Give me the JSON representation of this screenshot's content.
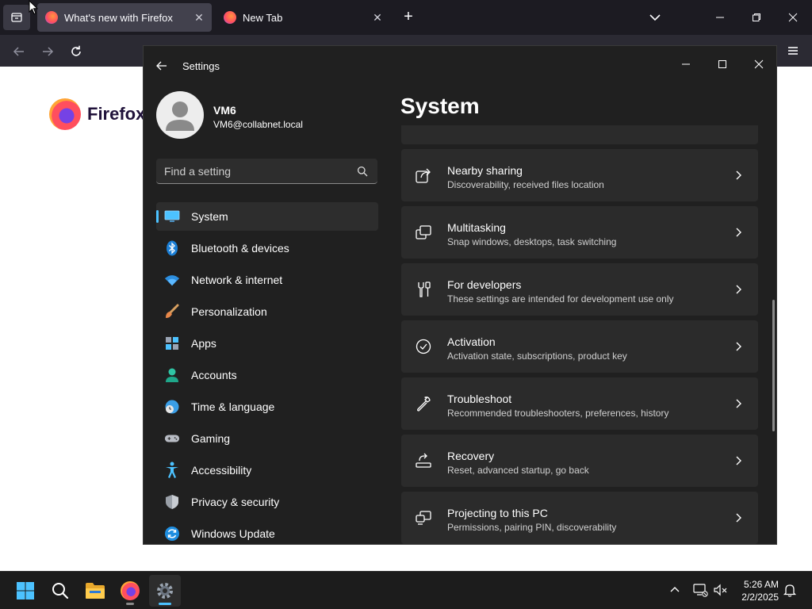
{
  "browser": {
    "tabs": [
      {
        "title": "What's new with Firefox",
        "active": true
      },
      {
        "title": "New Tab",
        "active": false
      }
    ],
    "new_tab_symbol": "+",
    "close_symbol": "✕",
    "logo_text": "Firefox"
  },
  "settings": {
    "window_title": "Settings",
    "user": {
      "name": "VM6",
      "email": "VM6@collabnet.local"
    },
    "search_placeholder": "Find a setting",
    "nav": [
      {
        "label": "System",
        "icon": "monitor-icon",
        "selected": true
      },
      {
        "label": "Bluetooth & devices",
        "icon": "bluetooth-icon"
      },
      {
        "label": "Network & internet",
        "icon": "wifi-icon"
      },
      {
        "label": "Personalization",
        "icon": "paintbrush-icon"
      },
      {
        "label": "Apps",
        "icon": "apps-icon"
      },
      {
        "label": "Accounts",
        "icon": "person-icon"
      },
      {
        "label": "Time & language",
        "icon": "globe-clock-icon"
      },
      {
        "label": "Gaming",
        "icon": "gamepad-icon"
      },
      {
        "label": "Accessibility",
        "icon": "accessibility-icon"
      },
      {
        "label": "Privacy & security",
        "icon": "shield-icon"
      },
      {
        "label": "Windows Update",
        "icon": "sync-icon"
      }
    ],
    "page_title": "System",
    "cards": [
      {
        "title": "Nearby sharing",
        "desc": "Discoverability, received files location",
        "icon": "share-icon"
      },
      {
        "title": "Multitasking",
        "desc": "Snap windows, desktops, task switching",
        "icon": "multitasking-icon"
      },
      {
        "title": "For developers",
        "desc": "These settings are intended for development use only",
        "icon": "developer-tools-icon"
      },
      {
        "title": "Activation",
        "desc": "Activation state, subscriptions, product key",
        "icon": "checkmark-circle-icon"
      },
      {
        "title": "Troubleshoot",
        "desc": "Recommended troubleshooters, preferences, history",
        "icon": "wrench-icon"
      },
      {
        "title": "Recovery",
        "desc": "Reset, advanced startup, go back",
        "icon": "recovery-icon"
      },
      {
        "title": "Projecting to this PC",
        "desc": "Permissions, pairing PIN, discoverability",
        "icon": "projecting-icon"
      }
    ]
  },
  "taskbar": {
    "apps": [
      "start-icon",
      "search-icon",
      "file-explorer-icon",
      "firefox-icon",
      "settings-gear-icon"
    ],
    "time": "5:26 AM",
    "date": "2/2/2025"
  },
  "colors": {
    "accent": "#4cc2ff",
    "settings_bg": "#202020",
    "card_bg": "#2b2b2b",
    "browser_tabbar": "#1c1b22"
  }
}
